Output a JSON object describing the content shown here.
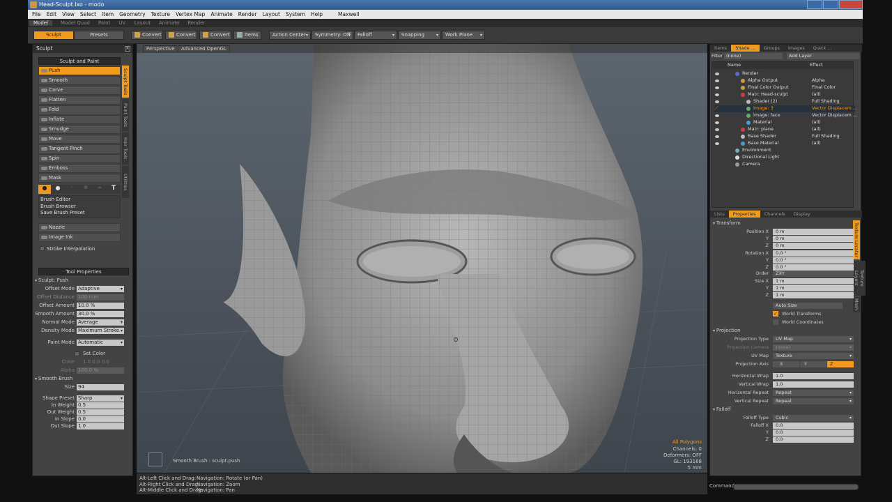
{
  "window": {
    "title": "Head-Sculpt.lxo - modo"
  },
  "menu": [
    "File",
    "Edit",
    "View",
    "Select",
    "Item",
    "Geometry",
    "Texture",
    "Vertex Map",
    "Animate",
    "Render",
    "Layout",
    "System",
    "Help",
    "Maxwell"
  ],
  "layouts": [
    "Model",
    "Model Quad",
    "Paint",
    "UV",
    "Layout",
    "Animate",
    "Render"
  ],
  "toolbar": {
    "sculpt": "Sculpt",
    "presets": "Presets",
    "convert1": "Convert",
    "convert2": "Convert",
    "convert3": "Convert",
    "items": "Items",
    "action_center": "Action Center",
    "symmetry": "Symmetry: Off",
    "falloff": "Falloff",
    "snapping": "Snapping",
    "work_plane": "Work Plane"
  },
  "sculpt_panel": {
    "title": "Sculpt",
    "header": "Sculpt and Paint",
    "tools": [
      "Push",
      "Smooth",
      "Carve",
      "Flatten",
      "Fold",
      "Inflate",
      "Smudge",
      "Move",
      "Tangent Pinch",
      "Spin",
      "Emboss",
      "Mask"
    ],
    "vtabs": [
      "Sculpt Tools",
      "Paint Tools",
      "Hair Tools",
      "Utilities"
    ],
    "brush_links": [
      "Brush Editor",
      "Brush Browser",
      "Save Brush Preset"
    ],
    "nozzle": "Nozzle",
    "image_ink": "Image Ink",
    "stroke_interp": "Stroke Interpolation",
    "tool_properties": "Tool Properties",
    "sculpt_push": "Sculpt: Push",
    "offset_mode_l": "Offset Mode",
    "offset_mode": "Adaptive",
    "offset_distance_l": "Offset Distance",
    "offset_distance": "100 mm",
    "offset_amount_l": "Offset Amount",
    "offset_amount": "10.0 %",
    "smooth_amount_l": "Smooth Amount",
    "smooth_amount": "30.0 %",
    "normal_mode_l": "Normal Mode",
    "normal_mode": "Average",
    "density_mode_l": "Density Mode",
    "density_mode": "Maximum Stroke",
    "paint_mode_l": "Paint Mode",
    "paint_mode": "Automatic",
    "set_color": "Set Color",
    "color_l": "Color",
    "color_vals": "1.0  0.0  0.0",
    "alpha_l": "Alpha",
    "alpha": "100.0 %",
    "smooth_brush": "Smooth Brush",
    "size_l": "Size",
    "size": "94",
    "shape_preset_l": "Shape Preset",
    "shape_preset": "Sharp",
    "in_weight_l": "In Weight",
    "in_weight": "0.5",
    "out_weight_l": "Out Weight",
    "out_weight": "0.5",
    "in_slope_l": "In Slope",
    "in_slope": "0.0",
    "out_slope_l": "Out Slope",
    "out_slope": "1.0"
  },
  "viewport": {
    "perspective": "Perspective",
    "opengl": "Advanced OpenGL",
    "all_polygons": "All Polygons",
    "channels": "Channels: 0",
    "deformers": "Deformers: OFF",
    "gl": "GL: 193168",
    "scale": "5 mm",
    "tool_hint": "Smooth Brush : sculpt.push"
  },
  "status": [
    "Alt-Left Click and Drag:",
    "Alt-Right Click and Drag:",
    "Alt-Middle Click and Drag:"
  ],
  "status_nav": [
    "Navigation: Rotate (or Pan)",
    "Navigation: Zoom",
    "Navigation: Pan"
  ],
  "shader_panel": {
    "tabs": [
      "Items",
      "Shade ...",
      "Groups",
      "Images",
      "Quick ..."
    ],
    "filter_l": "Filter",
    "filter": "(none)",
    "add_layer": "Add Layer",
    "col_name": "Name",
    "col_effect": "Effect",
    "rows": [
      {
        "name": "Render",
        "effect": ""
      },
      {
        "name": "Alpha Output",
        "effect": "Alpha"
      },
      {
        "name": "Final Color Output",
        "effect": "Final Color"
      },
      {
        "name": "Matr: Head-sculpt",
        "effect": "(all)"
      },
      {
        "name": "Shader (2)",
        "effect": "Full Shading"
      },
      {
        "name": "Image: 3",
        "effect": "Vector Displacem ..."
      },
      {
        "name": "Image: face",
        "effect": "Vector Displacem ..."
      },
      {
        "name": "Material",
        "effect": "(all)"
      },
      {
        "name": "Matr: plane",
        "effect": "(all)"
      },
      {
        "name": "Base Shader",
        "effect": "Full Shading"
      },
      {
        "name": "Base Material",
        "effect": "(all)"
      },
      {
        "name": "Environment",
        "effect": ""
      },
      {
        "name": "Directional Light",
        "effect": ""
      },
      {
        "name": "Camera",
        "effect": ""
      }
    ]
  },
  "props_panel": {
    "tabs": [
      "Lists",
      "Properties",
      "Channels",
      "Display"
    ],
    "vtabs": [
      "Texture Locator",
      "Texture Layers",
      "Mesh"
    ],
    "transform": "Transform",
    "pos_l": "Position X",
    "pos_x": "0 m",
    "pos_y": "0 m",
    "pos_z": "0 m",
    "rot_l": "Rotation X",
    "rot_x": "0.0 °",
    "rot_y": "0.0 °",
    "rot_z": "0.0 °",
    "y_l": "Y",
    "z_l": "Z",
    "order_l": "Order",
    "order": "ZXY",
    "size_l": "Size X",
    "size_x": "1 m",
    "size_y": "1 m",
    "size_z": "1 m",
    "auto_size": "Auto Size",
    "world_transforms": "World Transforms",
    "world_coords": "World Coordinates",
    "projection": "Projection",
    "proj_type_l": "Projection Type",
    "proj_type": "UV Map",
    "proj_cam_l": "Projection Camera",
    "proj_cam": "(none)",
    "uvmap_l": "UV Map",
    "uvmap": "Texture",
    "proj_axis_l": "Projection Axis",
    "axis_x": "X",
    "axis_y": "Y",
    "axis_z": "Z",
    "hwrap_l": "Horizontal Wrap",
    "hwrap": "1.0",
    "vwrap_l": "Vertical Wrap",
    "vwrap": "1.0",
    "hrep_l": "Horizontal Repeat",
    "hrep": "Repeat",
    "vrep_l": "Vertical Repeat",
    "vrep": "Repeat",
    "falloff": "Falloff",
    "ftype_l": "Falloff Type",
    "ftype": "Cubic",
    "fx_l": "Falloff X",
    "fx": "0.0",
    "fy": "0.0",
    "fz": "0.0"
  },
  "command_l": "Command"
}
